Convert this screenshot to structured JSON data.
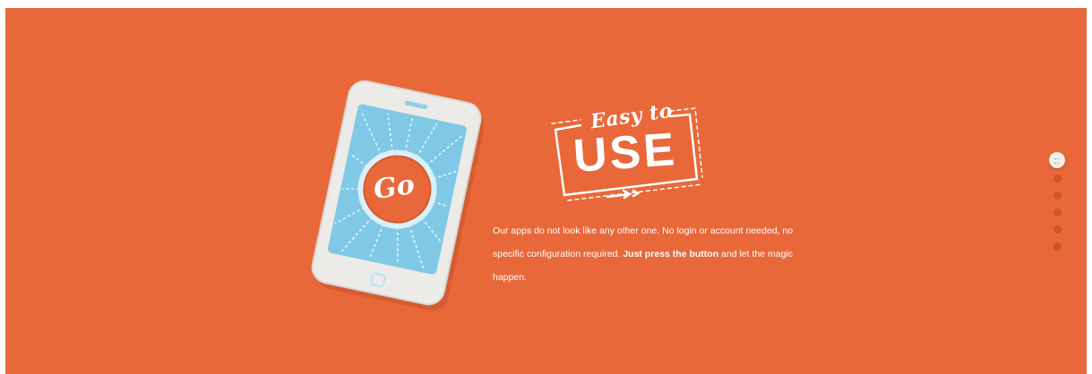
{
  "colors": {
    "background": "#e8683a",
    "text": "#ffffff",
    "inactive_dot": "#c9552d",
    "active_dot": "#f4efe9"
  },
  "tablet": {
    "button_label": "Go"
  },
  "badge": {
    "script_text": "Easy to",
    "main_text": "USE"
  },
  "description": {
    "part1": "Our apps do not look like any other one. No login or account needed, no specific configuration required. ",
    "bold": "Just press the button",
    "part2": " and let the magic happen."
  },
  "pagination": {
    "count": 6,
    "active_index": 0
  }
}
